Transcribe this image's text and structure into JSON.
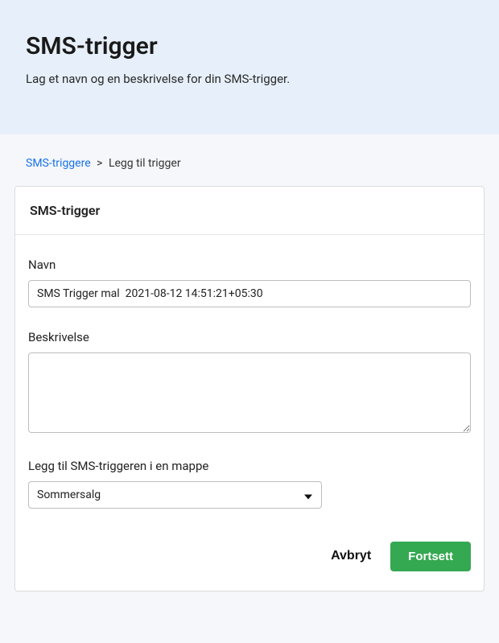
{
  "header": {
    "title": "SMS-trigger",
    "subtitle": "Lag et navn og en beskrivelse for din SMS-trigger."
  },
  "breadcrumb": {
    "parent": "SMS-triggere",
    "separator": ">",
    "current": "Legg til trigger"
  },
  "card": {
    "title": "SMS-trigger",
    "name_label": "Navn",
    "name_value": "SMS Trigger mal  2021-08-12 14:51:21+05:30",
    "desc_label": "Beskrivelse",
    "desc_value": "",
    "folder_label": "Legg til SMS-triggeren i en mappe",
    "folder_value": "Sommersalg"
  },
  "actions": {
    "cancel": "Avbryt",
    "continue": "Fortsett"
  }
}
